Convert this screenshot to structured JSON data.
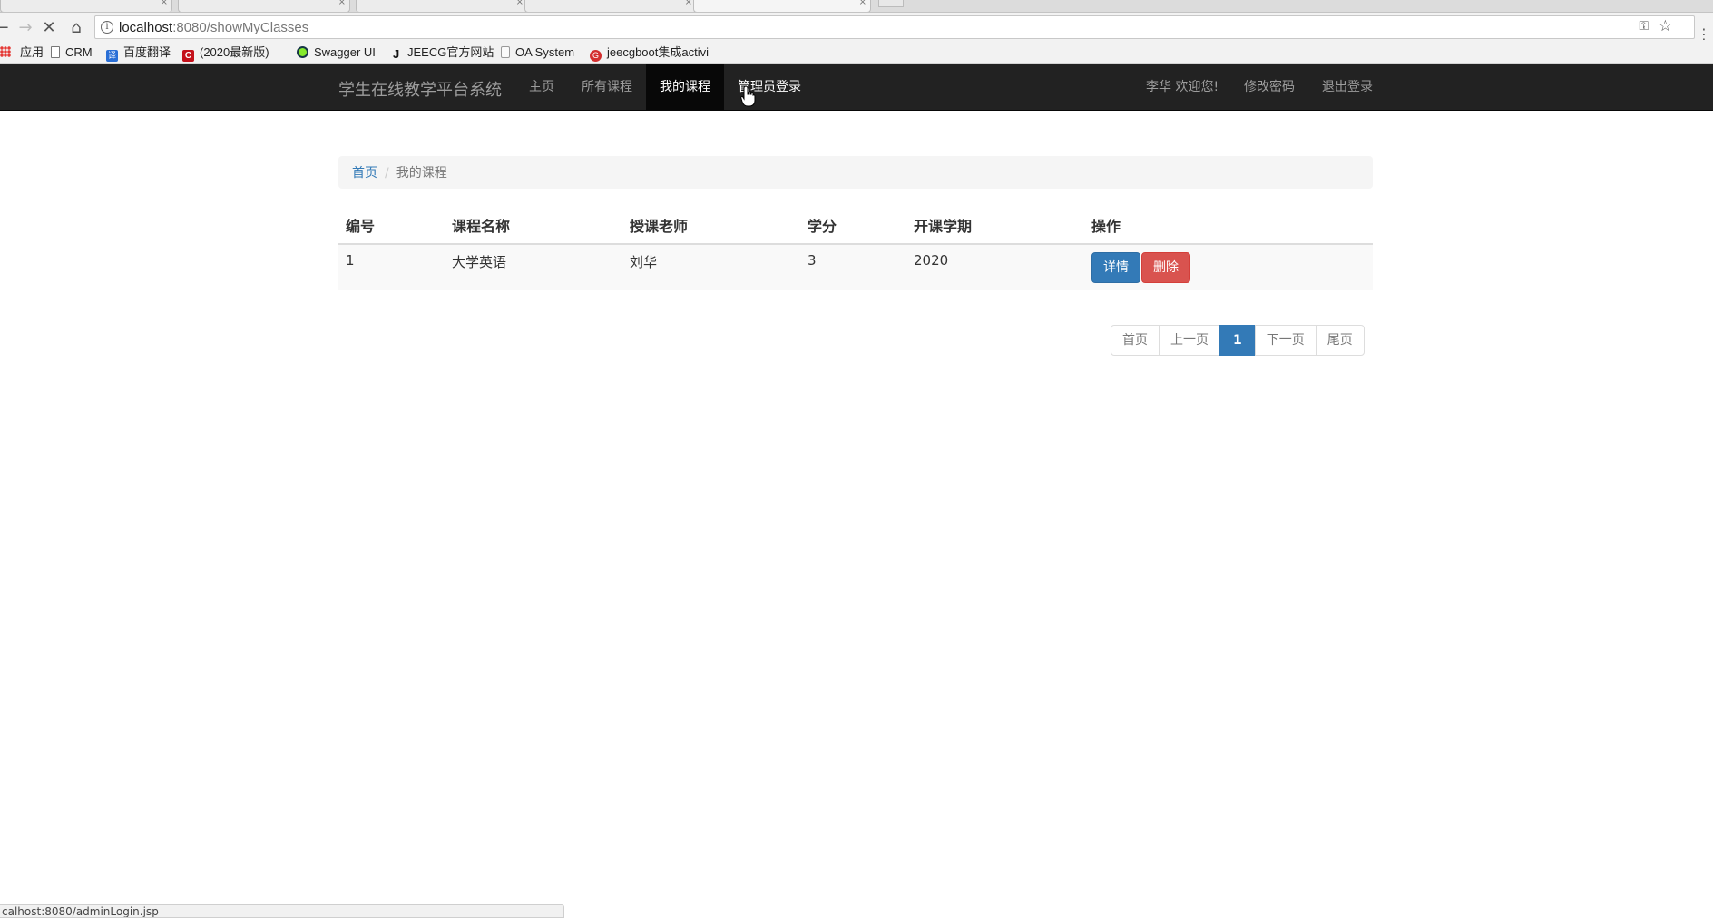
{
  "browser": {
    "url_host": "localhost",
    "url_rest": ":8080/showMyClasses",
    "bookmarks": [
      {
        "label": "应用",
        "icon": "apps-icon"
      },
      {
        "label": "CRM",
        "icon": "page-icon"
      },
      {
        "label": "百度翻译",
        "icon": "baidu-translate-icon"
      },
      {
        "label": "(2020最新版)",
        "icon": "c-logo-icon"
      },
      {
        "label": "Swagger UI",
        "icon": "swagger-icon"
      },
      {
        "label": "JEECG官方网站",
        "icon": "jeecg-icon"
      },
      {
        "label": "OA System",
        "icon": "page-icon"
      },
      {
        "label": "jeecgboot集成activi",
        "icon": "jeecgboot-icon"
      }
    ],
    "status_url": "calhost:8080/adminLogin.jsp"
  },
  "navbar": {
    "brand": "学生在线教学平台系统",
    "links": [
      {
        "label": "主页"
      },
      {
        "label": "所有课程"
      },
      {
        "label": "我的课程"
      },
      {
        "label": "管理员登录"
      }
    ],
    "user_greeting": "李华 欢迎您!",
    "change_password": "修改密码",
    "logout": "退出登录"
  },
  "breadcrumb": {
    "home": "首页",
    "separator": "/",
    "current": "我的课程"
  },
  "table": {
    "headers": [
      "编号",
      "课程名称",
      "授课老师",
      "学分",
      "开课学期",
      "操作"
    ],
    "rows": [
      {
        "id": "1",
        "name": "大学英语",
        "teacher": "刘华",
        "credit": "3",
        "term": "2020",
        "detail_label": "详情",
        "delete_label": "删除"
      }
    ]
  },
  "pagination": {
    "first": "首页",
    "prev": "上一页",
    "current": "1",
    "next": "下一页",
    "last": "尾页"
  },
  "colors": {
    "navbar_bg": "#222222",
    "primary": "#337ab7",
    "danger": "#d9534f"
  }
}
